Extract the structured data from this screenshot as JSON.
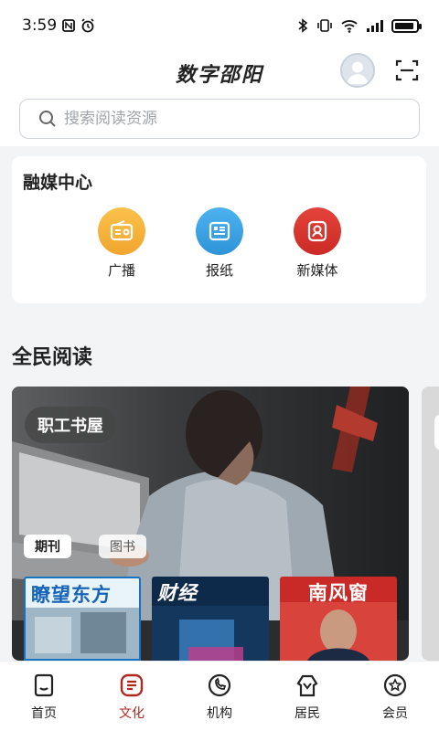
{
  "status_bar": {
    "time": "3:59"
  },
  "header": {
    "app_title": "数字邵阳",
    "search_placeholder": "搜索阅读资源"
  },
  "media_center": {
    "title": "融媒中心",
    "items": [
      {
        "label": "广播",
        "icon": "radio-icon",
        "color": "#f6b23a"
      },
      {
        "label": "报纸",
        "icon": "newspaper-icon",
        "color": "#3fa2e4"
      },
      {
        "label": "新媒体",
        "icon": "new-media-icon",
        "color": "#d8342e"
      }
    ]
  },
  "reading": {
    "title": "全民阅读",
    "card_tag": "职工书屋",
    "chips": [
      "期刊",
      "图书"
    ],
    "magazines": [
      {
        "title": "瞭望东方"
      },
      {
        "title": "财经"
      },
      {
        "title": "南风窗"
      }
    ]
  },
  "bottom_nav": [
    {
      "label": "首页",
      "icon": "home-icon"
    },
    {
      "label": "文化",
      "icon": "culture-icon",
      "active": true
    },
    {
      "label": "机构",
      "icon": "institution-icon"
    },
    {
      "label": "居民",
      "icon": "resident-icon"
    },
    {
      "label": "会员",
      "icon": "member-icon"
    }
  ],
  "colors": {
    "accent": "#b3261e",
    "background": "#f3f4f6"
  }
}
